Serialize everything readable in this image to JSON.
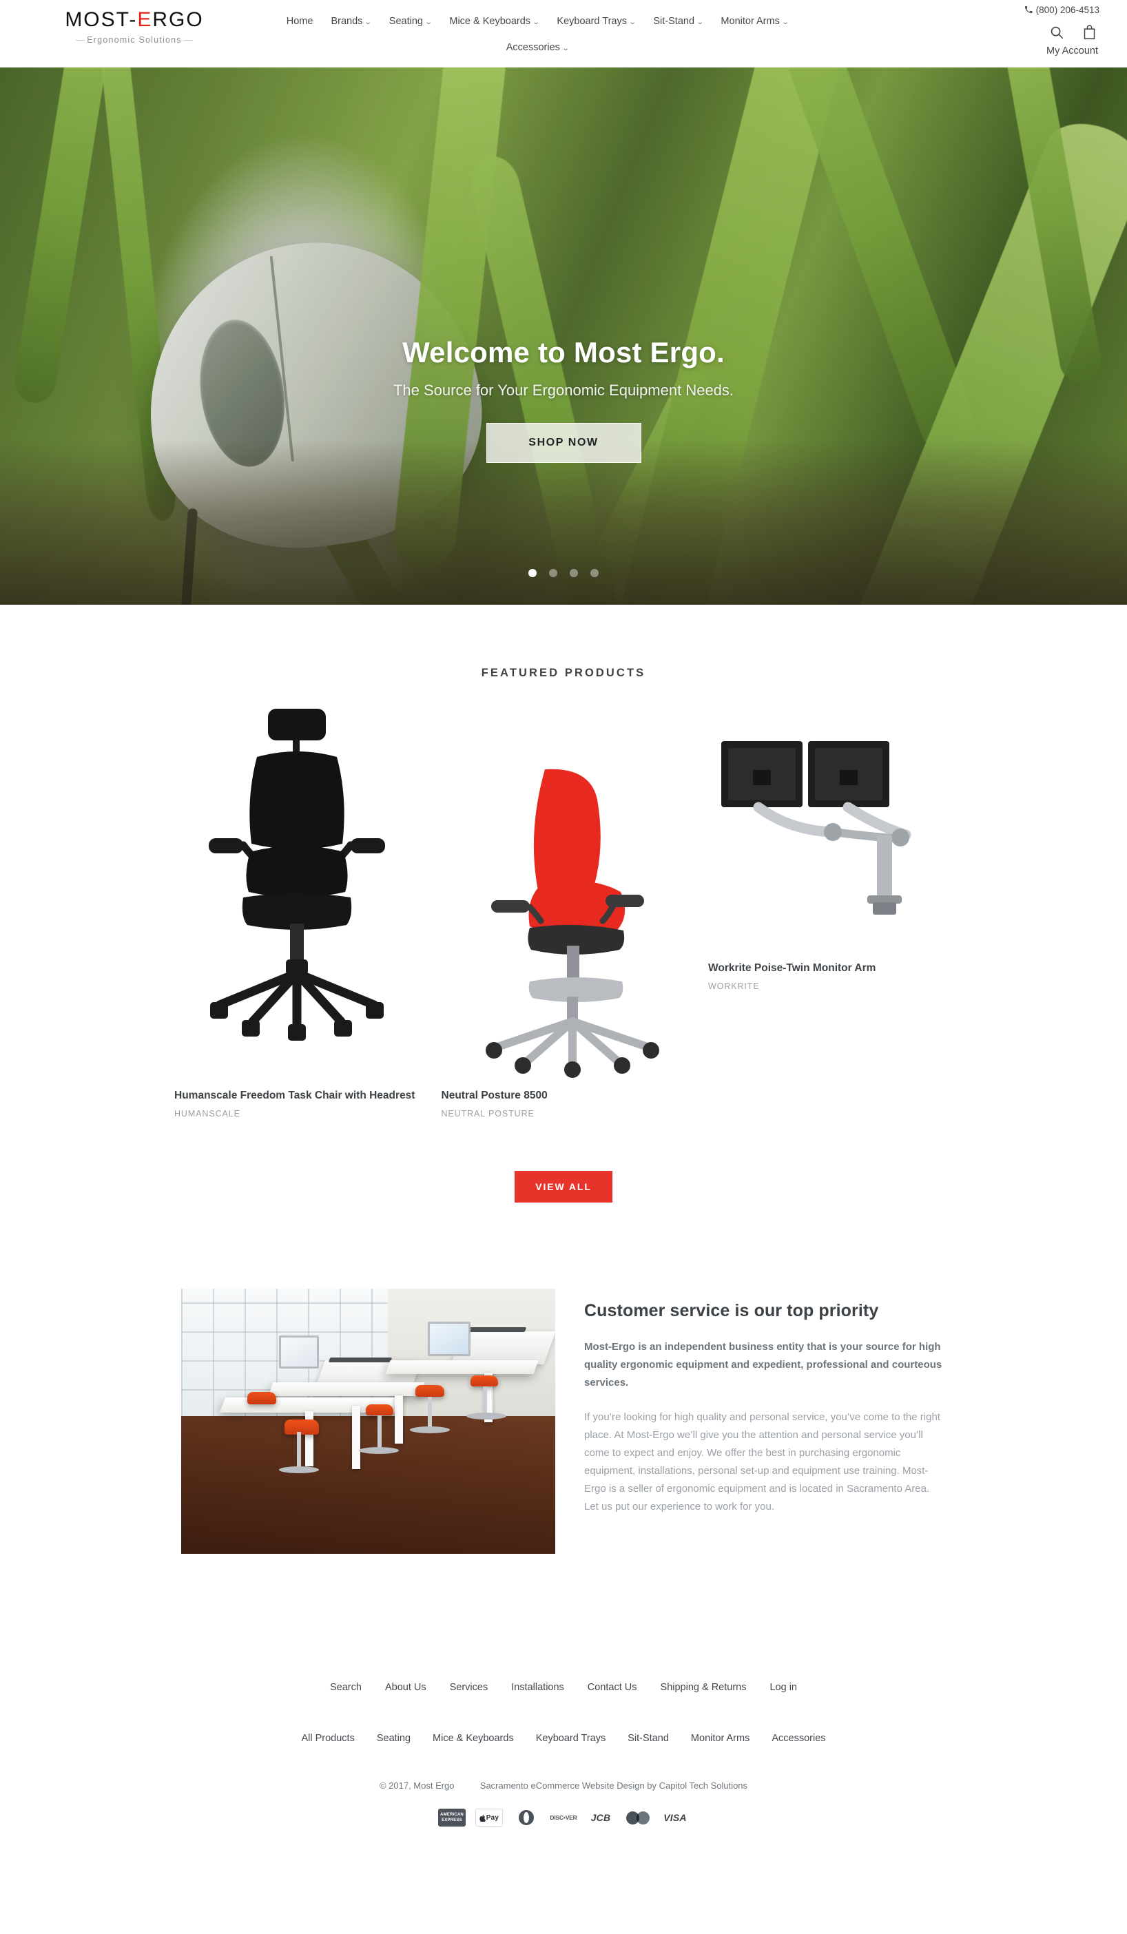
{
  "header": {
    "logo": {
      "prefix": "MOST-",
      "accent_letter": "E",
      "suffix": "RGO",
      "accent_color": "#e2231a",
      "tagline": "Ergonomic Solutions"
    },
    "nav_row1": [
      {
        "label": "Home",
        "has_caret": false
      },
      {
        "label": "Brands",
        "has_caret": true
      },
      {
        "label": "Seating",
        "has_caret": true
      },
      {
        "label": "Mice & Keyboards",
        "has_caret": true
      },
      {
        "label": "Keyboard Trays",
        "has_caret": true
      },
      {
        "label": "Sit-Stand",
        "has_caret": true
      },
      {
        "label": "Monitor Arms",
        "has_caret": true
      }
    ],
    "nav_row2": [
      {
        "label": "Accessories",
        "has_caret": true
      }
    ],
    "phone": "(800) 206-4513",
    "phone_icon": "phone-icon",
    "search_icon": "search-icon",
    "cart_icon": "shopping-bag-icon",
    "my_account": "My Account"
  },
  "hero": {
    "title": "Welcome to Most Ergo.",
    "subtitle": "The Source for Your Ergonomic Equipment Needs.",
    "cta": "SHOP NOW",
    "slides_total": 4,
    "active_slide": 1
  },
  "featured": {
    "title": "FEATURED PRODUCTS",
    "products": [
      {
        "name": "Humanscale Freedom Task Chair with Headrest",
        "vendor": "HUMANSCALE",
        "image": "black-office-chair-with-headrest"
      },
      {
        "name": "Neutral Posture 8500",
        "vendor": "NEUTRAL POSTURE",
        "image": "red-office-task-chair"
      },
      {
        "name": "Workrite Poise-Twin Monitor Arm",
        "vendor": "WORKRITE",
        "image": "dual-monitor-arm-mount"
      }
    ],
    "view_all": "VIEW ALL",
    "view_all_color": "#e8332a"
  },
  "customer_service": {
    "image": "office-sit-stand-desks-photo",
    "heading": "Customer service is our top priority",
    "lead": "Most-Ergo is an independent business entity that is your source for high quality ergonomic equipment and expedient, professional and courteous services.",
    "body": "If you’re looking for high quality and personal service, you’ve come to the right place. At Most-Ergo we’ll give you the attention and personal service you’ll come to expect and enjoy. We offer the best in purchasing ergonomic equipment, installations, personal set-up and equipment use training. Most-Ergo is a seller of ergonomic equipment and is located in Sacramento Area. Let us put our experience to work for you."
  },
  "footer": {
    "links": [
      "Search",
      "About Us",
      "Services",
      "Installations",
      "Contact Us",
      "Shipping & Returns",
      "Log in"
    ],
    "categories": [
      "All Products",
      "Seating",
      "Mice & Keyboards",
      "Keyboard Trays",
      "Sit-Stand",
      "Monitor Arms",
      "Accessories"
    ],
    "copyright": "© 2017, Most Ergo",
    "credit": "Sacramento eCommerce Website Design by Capitol Tech Solutions",
    "payment_methods": [
      {
        "name": "American Express",
        "icon": "amex-icon",
        "l1": "AMERICAN",
        "l2": "EXPRESS"
      },
      {
        "name": "Apple Pay",
        "icon": "apple-pay-icon",
        "label": "Pay"
      },
      {
        "name": "Diners Club",
        "icon": "diners-club-icon"
      },
      {
        "name": "Discover",
        "icon": "discover-icon",
        "label": "DISC•VER"
      },
      {
        "name": "JCB",
        "icon": "jcb-icon",
        "label": "JCB"
      },
      {
        "name": "Mastercard",
        "icon": "mastercard-icon"
      },
      {
        "name": "Visa",
        "icon": "visa-icon",
        "label": "VISA"
      }
    ]
  }
}
